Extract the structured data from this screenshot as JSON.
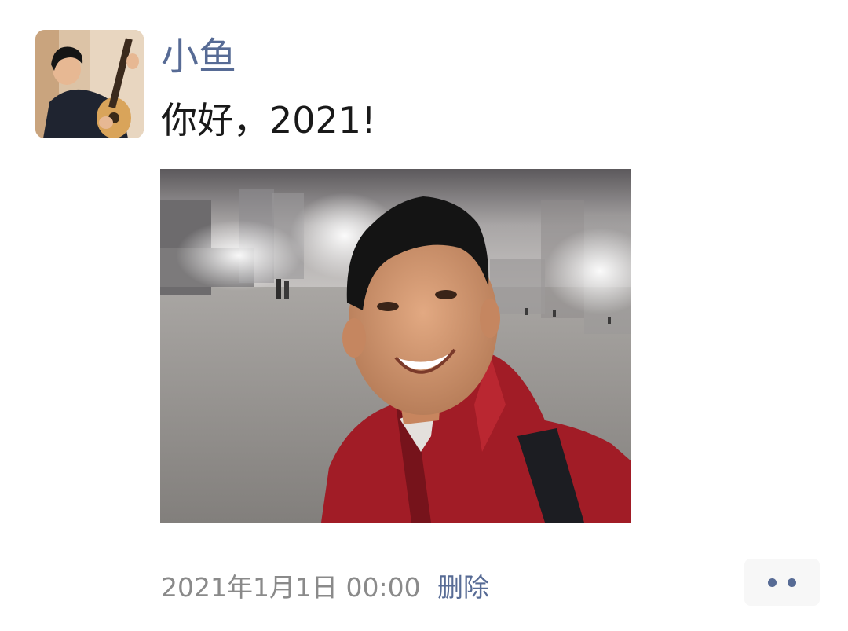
{
  "post": {
    "author_name": "小鱼",
    "text": "你好，2021!",
    "timestamp": "2021年1月1日 00:00",
    "delete_label": "删除"
  },
  "icons": {
    "avatar": "avatar-photo",
    "more": "more-dots-icon"
  },
  "colors": {
    "name_link": "#576b95",
    "timestamp": "#8a8a8a",
    "text": "#191919"
  }
}
